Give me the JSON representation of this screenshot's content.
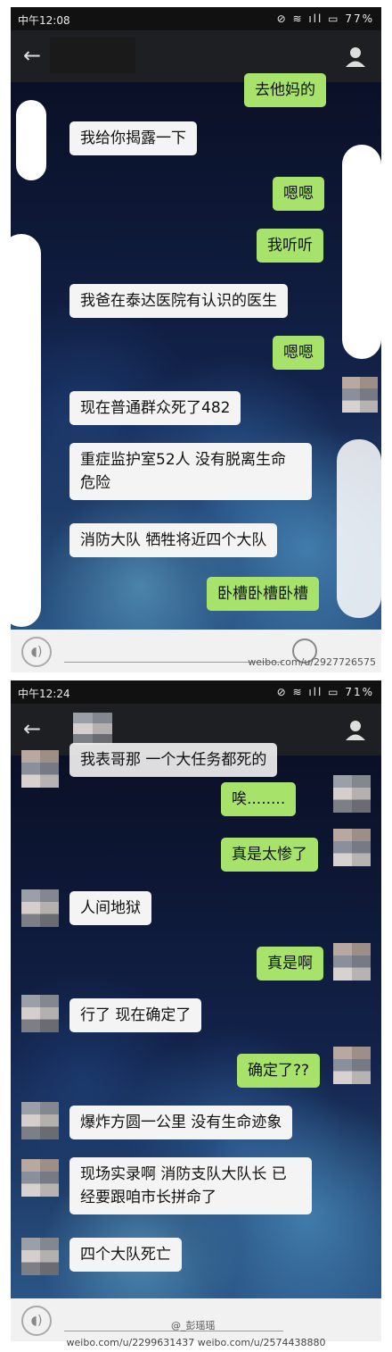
{
  "screenshot1": {
    "status": {
      "time": "中午12:08",
      "battery": "77%"
    },
    "messages": [
      {
        "side": "out",
        "text": "去他妈的"
      },
      {
        "side": "in",
        "text": "我给你揭露一下"
      },
      {
        "side": "out",
        "text": "嗯嗯"
      },
      {
        "side": "out",
        "text": "我听听"
      },
      {
        "side": "in",
        "text": "我爸在泰达医院有认识的医生"
      },
      {
        "side": "out",
        "text": "嗯嗯"
      },
      {
        "side": "in",
        "text": "现在普通群众死了482"
      },
      {
        "side": "in",
        "text": "重症监护室52人 没有脱离生命危险"
      },
      {
        "side": "in",
        "text": "消防大队 牺牲将近四个大队"
      },
      {
        "side": "out",
        "text": "卧槽卧槽卧槽"
      }
    ],
    "input": {
      "watermark": "weibo.com/u/2927726575"
    }
  },
  "screenshot2": {
    "status": {
      "time": "中午12:24",
      "battery": "71%"
    },
    "messages": [
      {
        "side": "in",
        "text": "我表哥那 一个大任务都死的"
      },
      {
        "side": "out",
        "text": "唉........"
      },
      {
        "side": "out",
        "text": "真是太惨了"
      },
      {
        "side": "in",
        "text": "人间地狱"
      },
      {
        "side": "out",
        "text": "真是啊"
      },
      {
        "side": "in",
        "text": "行了 现在确定了"
      },
      {
        "side": "out",
        "text": "确定了??"
      },
      {
        "side": "in",
        "text": "爆炸方圆一公里 没有生命迹象"
      },
      {
        "side": "in",
        "text": "现场实录啊 消防支队大队长 已经要跟咱市长拼命了"
      },
      {
        "side": "in",
        "text": "四个大队死亡"
      }
    ],
    "input": {
      "watermark": "@_彭瑶瑶"
    }
  },
  "caption": "weibo.com/u/2299631437   weibo.com/u/2574438880"
}
